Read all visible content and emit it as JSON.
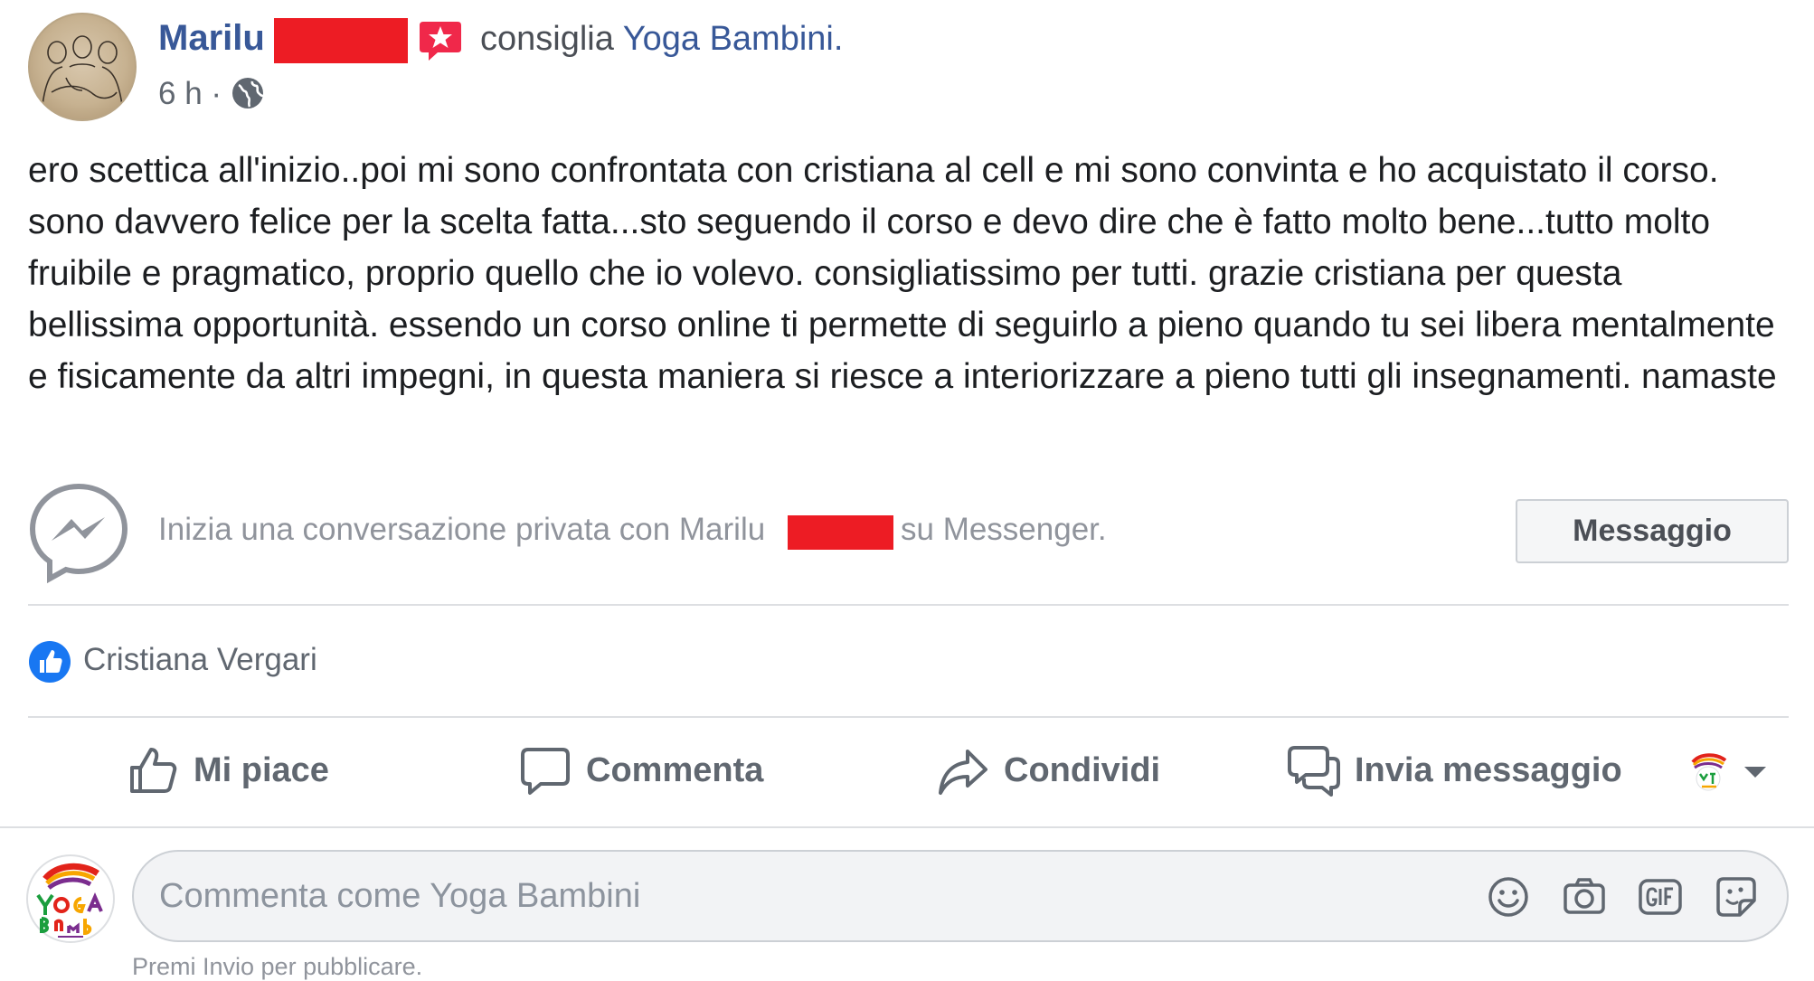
{
  "post": {
    "author_name": "Marilu",
    "action_text": "consiglia",
    "page_name": "Yoga Bambini.",
    "time": "6 h",
    "separator": "·",
    "body": "ero scettica all'inizio..poi mi sono confrontata con cristiana al cell e mi sono convinta e ho acquistato il corso. sono davvero felice per la scelta fatta...sto seguendo il corso e devo dire che è fatto molto bene...tutto molto fruibile e pragmatico, proprio quello che io volevo. consigliatissimo per tutti. grazie cristiana per questa bellissima opportunità. essendo un corso online ti permette di seguirlo a pieno quando tu sei libera mentalmente e fisicamente da altri impegni, in questa maniera si riesce a interiorizzare a pieno tutti gli insegnamenti. namaste"
  },
  "messenger": {
    "prompt_prefix": "Inizia una conversazione privata con Marilu",
    "prompt_suffix": "su Messenger.",
    "button_label": "Messaggio"
  },
  "reactions": {
    "liker_name": "Cristiana Vergari"
  },
  "actions": {
    "like_label": "Mi piace",
    "comment_label": "Commenta",
    "share_label": "Condividi",
    "send_label": "Invia messaggio"
  },
  "comment": {
    "placeholder": "Commenta come Yoga Bambini",
    "hint": "Premi Invio per pubblicare."
  },
  "colors": {
    "link": "#385898",
    "redaction": "#ed1c24",
    "like_blue": "#1877f2"
  },
  "icons": [
    "recommendation-star-icon",
    "globe-icon",
    "messenger-icon",
    "like-thumb-icon",
    "comment-bubble-icon",
    "share-arrow-icon",
    "send-message-icon",
    "emoji-icon",
    "camera-icon",
    "gif-icon",
    "sticker-icon",
    "chevron-down-icon"
  ]
}
